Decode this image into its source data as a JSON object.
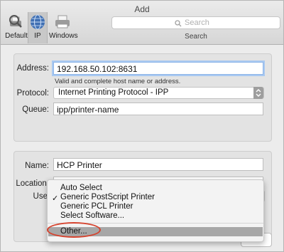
{
  "window": {
    "title": "Add"
  },
  "toolbar": {
    "default_label": "Default",
    "ip_label": "IP",
    "windows_label": "Windows",
    "search_placeholder": "Search",
    "search_caption": "Search"
  },
  "form": {
    "address_label": "Address:",
    "address_value": "192.168.50.102:8631",
    "address_hint": "Valid and complete host name or address.",
    "protocol_label": "Protocol:",
    "protocol_value": "Internet Printing Protocol - IPP",
    "queue_label": "Queue:",
    "queue_value": "ipp/printer-name",
    "name_label": "Name:",
    "name_value": "HCP Printer",
    "location_label": "Location:",
    "use_label": "Use"
  },
  "use_menu": {
    "items": [
      {
        "label": "Auto Select",
        "checked": false
      },
      {
        "label": "Generic PostScript Printer",
        "checked": true
      },
      {
        "label": "Generic PCL Printer",
        "checked": false
      },
      {
        "label": "Select Software...",
        "checked": false
      },
      {
        "label": "Other...",
        "checked": false,
        "highlighted": true
      }
    ],
    "checkmark": "✓"
  },
  "buttons": {
    "add_label": "Add"
  },
  "colors": {
    "highlight_ring": "#d6422d",
    "focus_ring": "#a9c9f1"
  }
}
